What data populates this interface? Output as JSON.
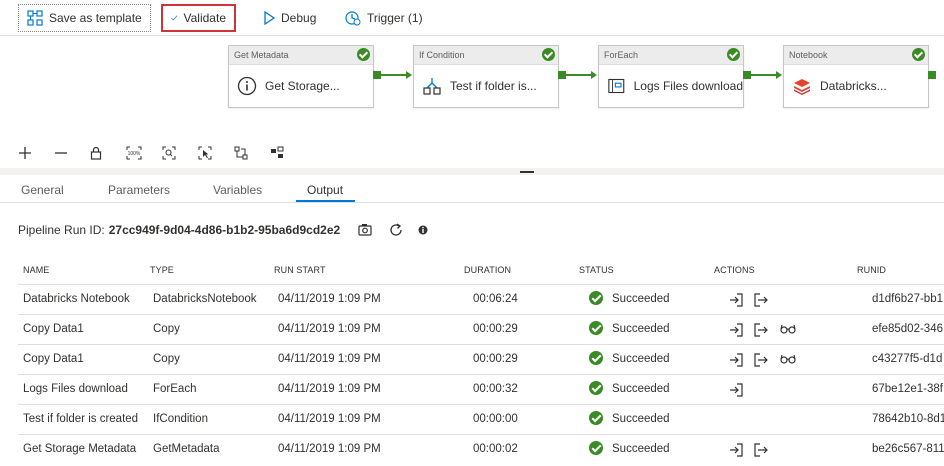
{
  "toolbar": {
    "save_template": "Save as template",
    "validate": "Validate",
    "debug": "Debug",
    "trigger": "Trigger (1)"
  },
  "pipeline": {
    "nodes": [
      {
        "type": "Get Metadata",
        "name": "Get Storage...",
        "icon": "info-icon"
      },
      {
        "type": "If Condition",
        "name": "Test if folder is...",
        "icon": "if-condition-icon"
      },
      {
        "type": "ForEach",
        "name": "Logs Files download",
        "icon": "foreach-icon"
      },
      {
        "type": "Notebook",
        "name": "Databricks...",
        "icon": "databricks-icon"
      }
    ]
  },
  "canvas_tools": [
    "add-icon",
    "zoom-out-icon",
    "lock-icon",
    "zoom-100-icon",
    "zoom-fit-icon",
    "select-icon",
    "auto-align-icon",
    "layout-icon"
  ],
  "tabs": [
    "General",
    "Parameters",
    "Variables",
    "Output"
  ],
  "active_tab": "Output",
  "run": {
    "label": "Pipeline Run ID:",
    "id": "27cc949f-9d04-4d86-b1b2-95ba6d9cd2e2"
  },
  "table": {
    "headers": {
      "name": "NAME",
      "type": "TYPE",
      "run_start": "RUN START",
      "duration": "DURATION",
      "status": "STATUS",
      "actions": "ACTIONS",
      "runid": "RUNID"
    },
    "rows": [
      {
        "name": "Databricks Notebook",
        "type": "DatabricksNotebook",
        "run_start": "04/11/2019 1:09 PM",
        "duration": "00:06:24",
        "status": "Succeeded",
        "runid": "d1df6b27-bb1",
        "actions": [
          "input",
          "output"
        ]
      },
      {
        "name": "Copy Data1",
        "type": "Copy",
        "run_start": "04/11/2019 1:09 PM",
        "duration": "00:00:29",
        "status": "Succeeded",
        "runid": "efe85d02-346",
        "actions": [
          "input",
          "output",
          "details"
        ]
      },
      {
        "name": "Copy Data1",
        "type": "Copy",
        "run_start": "04/11/2019 1:09 PM",
        "duration": "00:00:29",
        "status": "Succeeded",
        "runid": "c43277f5-d1d",
        "actions": [
          "input",
          "output",
          "details"
        ]
      },
      {
        "name": "Logs Files download",
        "type": "ForEach",
        "run_start": "04/11/2019 1:09 PM",
        "duration": "00:00:32",
        "status": "Succeeded",
        "runid": "67be12e1-38f",
        "actions": [
          "input"
        ]
      },
      {
        "name": "Test if folder is created",
        "type": "IfCondition",
        "run_start": "04/11/2019 1:09 PM",
        "duration": "00:00:00",
        "status": "Succeeded",
        "runid": "78642b10-8d1",
        "actions": []
      },
      {
        "name": "Get Storage Metadata",
        "type": "GetMetadata",
        "run_start": "04/11/2019 1:09 PM",
        "duration": "00:00:02",
        "status": "Succeeded",
        "runid": "be26c567-811",
        "actions": [
          "input",
          "output"
        ]
      }
    ]
  },
  "colors": {
    "accent": "#0078d4",
    "success": "#3a8a25",
    "validate_border": "#d13438"
  }
}
